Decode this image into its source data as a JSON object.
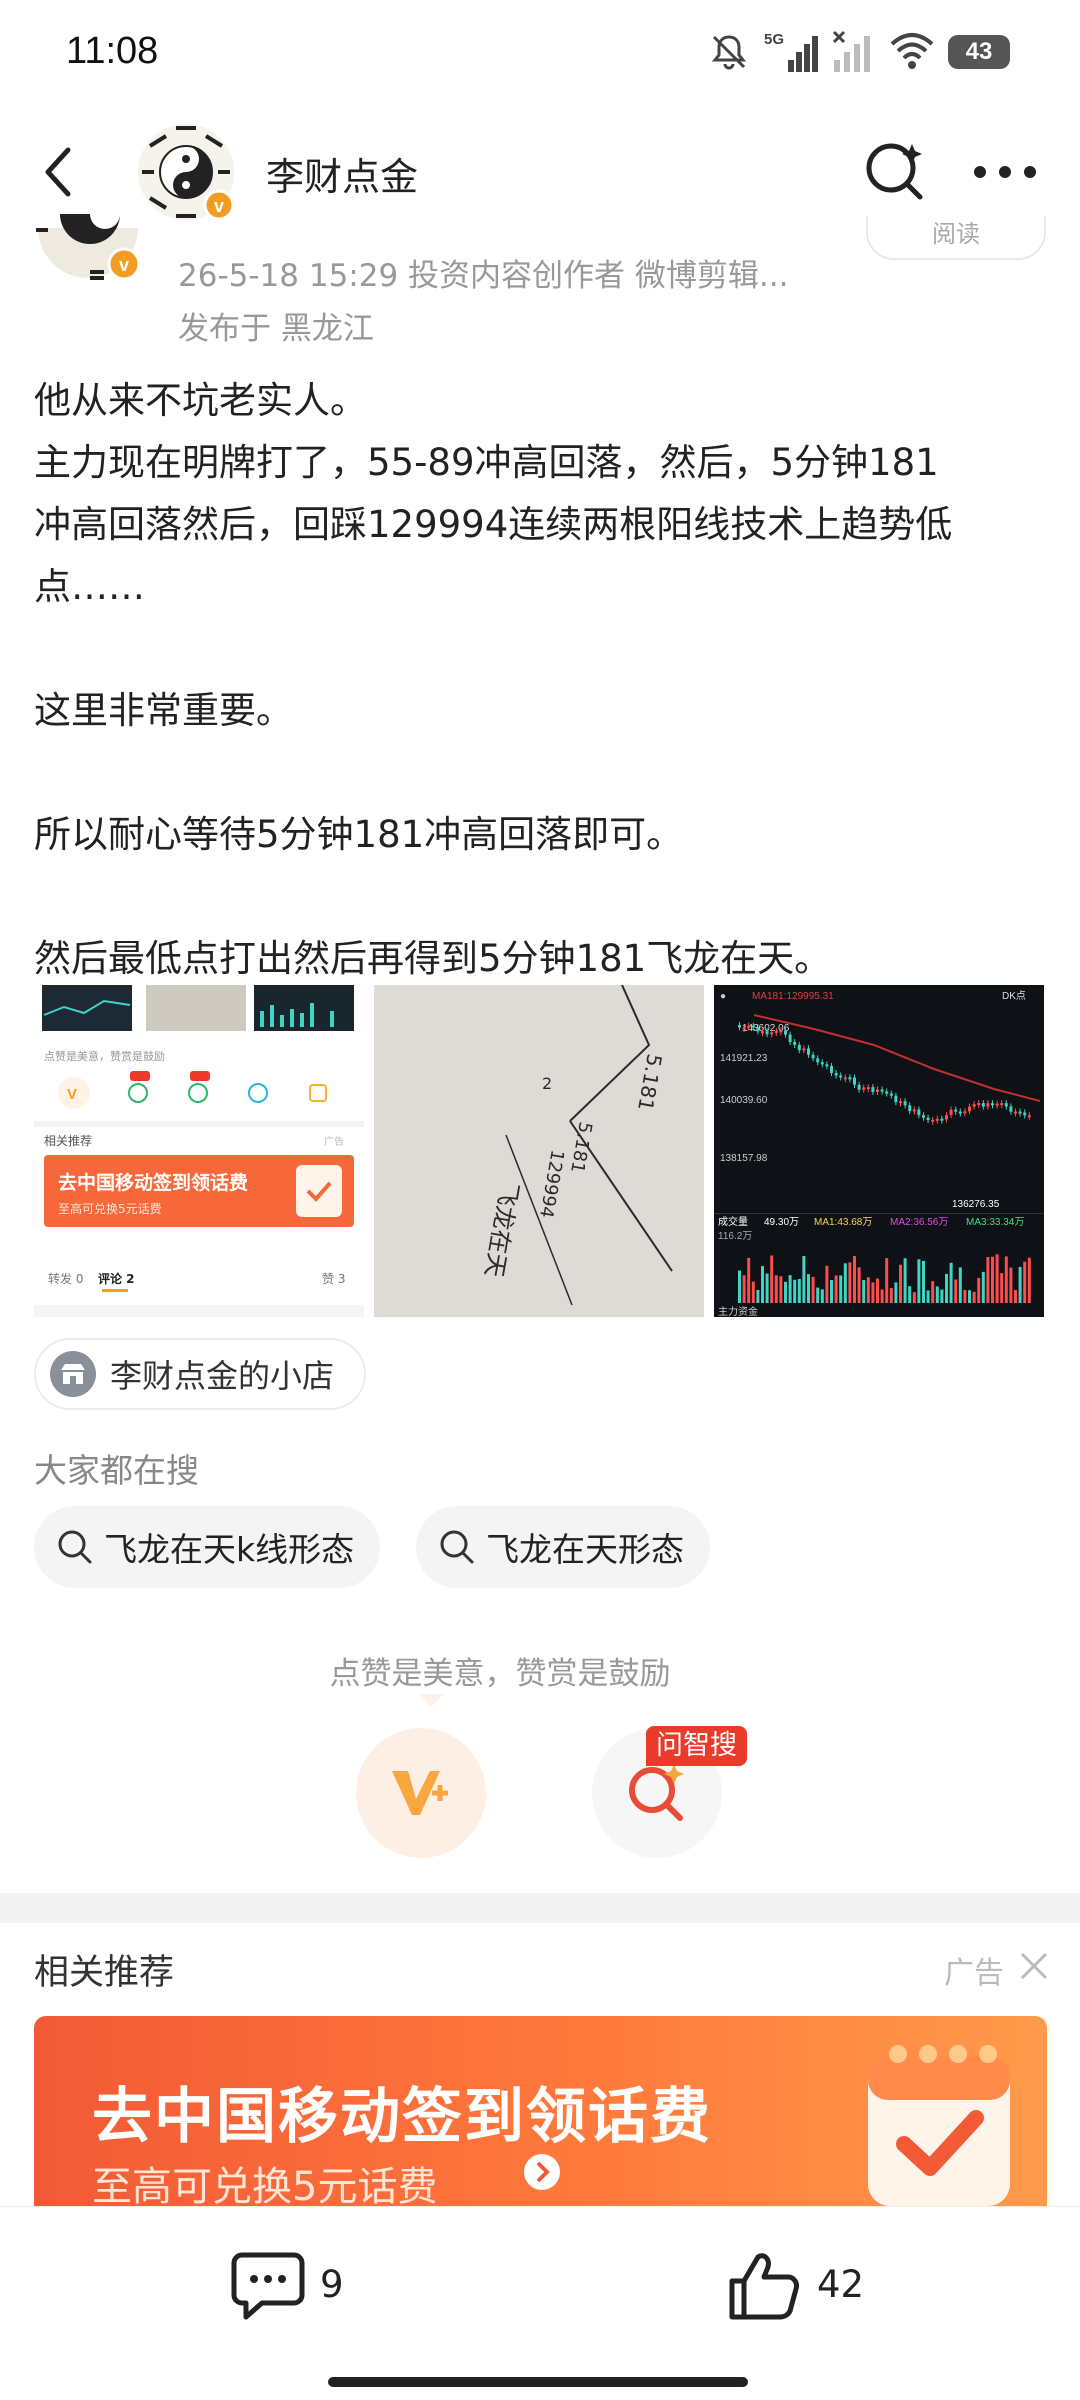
{
  "status_bar": {
    "time": "11:08",
    "network": "5G",
    "battery": "43"
  },
  "header": {
    "title": "李财点金"
  },
  "post_meta": {
    "line1": "26-5-18 15:29  投资内容创作者 微博剪辑...",
    "line2": "发布于 黑龙江",
    "read_label": "阅读"
  },
  "article": {
    "lines": [
      "他从来不坑老实人。",
      "主力现在明牌打了，55-89冲高回落，然后，5分钟181",
      "冲高回落然后，回踩129994连续两根阳线技术上趋势低",
      "点……",
      "这里非常重要。",
      "所以耐心等待5分钟181冲高回落即可。",
      "然后最低点打出然后再得到5分钟181飞龙在天。"
    ]
  },
  "images": {
    "thumb1": {
      "reward_note": "点赞是美意，赞赏是鼓励",
      "rec_title": "相关推荐",
      "ad_label": "广告",
      "ad_main": "去中国移动签到领话费",
      "ad_sub": "至高可兑换5元话费",
      "tab_repost": "转发 0",
      "tab_comment": "评论 2",
      "tab_like": "赞 3"
    },
    "thumb2": {
      "hand_1": "5.181",
      "hand_2": "5.181",
      "hand_3": "129994",
      "hand_4": "飞龙在天",
      "hand_5": "2"
    },
    "thumb3": {
      "ma_label": "MA181:129995.31",
      "dk_label": "DK点",
      "price_top": "143602.06",
      "price_1": "141921.23",
      "price_2": "140039.60",
      "price_3": "138157.98",
      "price_low": "136276.35",
      "vol_label": "成交量",
      "vol_val": "49.30万",
      "ma1": "MA1:43.68万",
      "ma2": "MA2:36.56万",
      "ma3": "MA3:33.34万",
      "vol_top": "116.2万",
      "main_flow": "主力资金"
    }
  },
  "shop": {
    "label": "李财点金的小店"
  },
  "search": {
    "heading": "大家都在搜",
    "tags": [
      "飞龙在天k线形态",
      "飞龙在天形态"
    ]
  },
  "reward": {
    "note": "点赞是美意，赞赏是鼓励",
    "ai_badge": "问智搜"
  },
  "recommend": {
    "title": "相关推荐",
    "ad_label": "广告",
    "ad_main": "去中国移动签到领话费",
    "ad_sub": "至高可兑换5元话费"
  },
  "bottom_bar": {
    "comment_count": "9",
    "like_count": "42"
  },
  "colors": {
    "accent_orange": "#ff7a3c",
    "ad_red": "#f25a36",
    "badge_red": "#e93a2a",
    "text_gray": "#999999"
  }
}
